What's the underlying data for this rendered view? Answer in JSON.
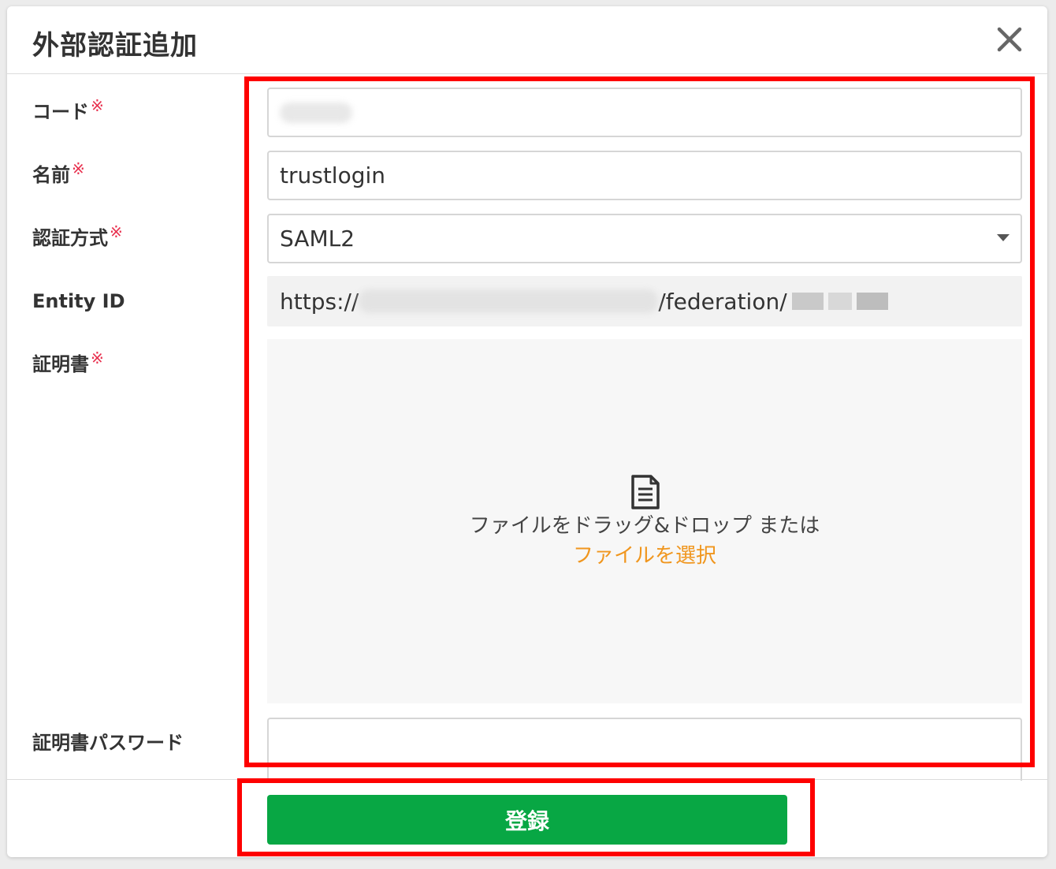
{
  "dialog": {
    "title": "外部認証追加",
    "close_icon": "close-icon"
  },
  "form": {
    "code": {
      "label": "コード",
      "required_mark": "※",
      "value": ""
    },
    "name": {
      "label": "名前",
      "required_mark": "※",
      "value": "trustlogin"
    },
    "auth_method": {
      "label": "認証方式",
      "required_mark": "※",
      "selected": "SAML2"
    },
    "entity_id": {
      "label": "Entity ID",
      "prefix": "https://",
      "suffix": "/federation/"
    },
    "certificate": {
      "label": "証明書",
      "required_mark": "※",
      "dropzone_text": "ファイルをドラッグ&ドロップ または",
      "select_link": "ファイルを選択",
      "icon": "document-icon"
    },
    "certificate_password": {
      "label": "証明書パスワード",
      "value": ""
    }
  },
  "footer": {
    "submit_label": "登録"
  },
  "colors": {
    "submit": "#08a744",
    "link": "#f0961e",
    "required": "#e8304e",
    "highlight": "#fe0000"
  }
}
